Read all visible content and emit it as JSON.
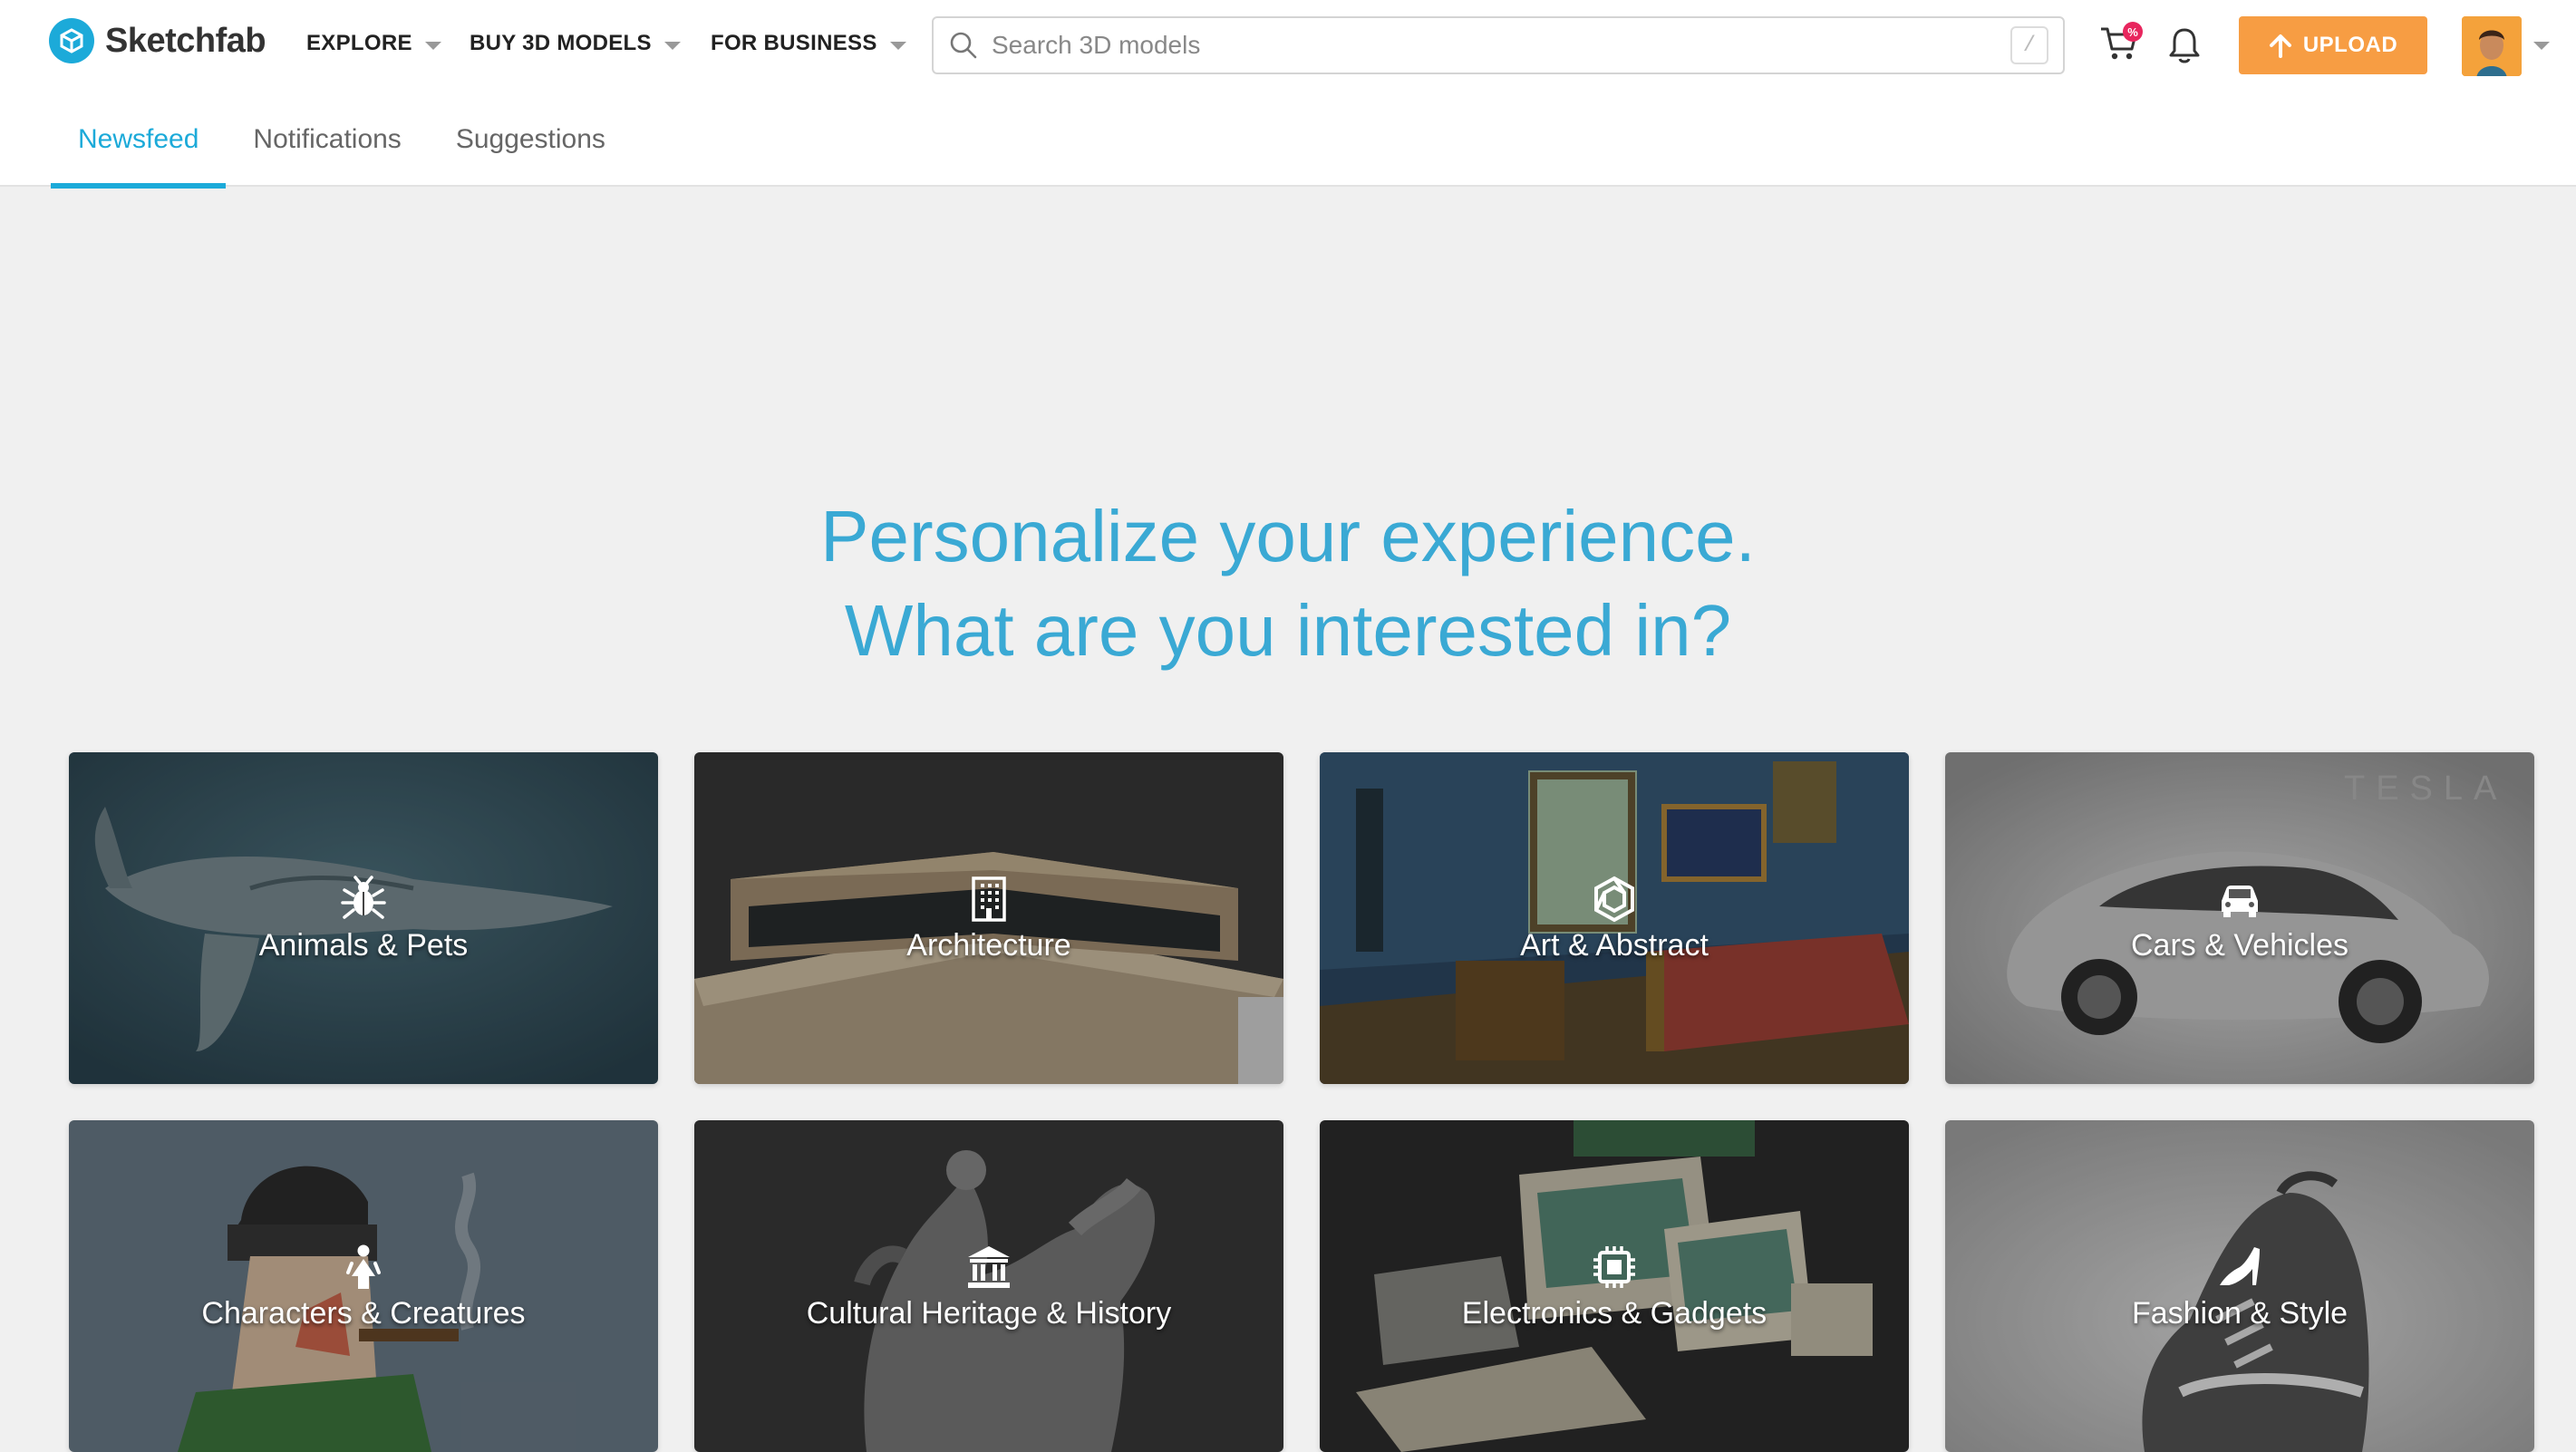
{
  "brand": {
    "name": "Sketchfab",
    "logo_icon": "sketchfab-cube-icon",
    "accent": "#1caad9"
  },
  "nav": {
    "explore_label": "EXPLORE",
    "buy_label": "BUY 3D MODELS",
    "business_label": "FOR BUSINESS"
  },
  "search": {
    "placeholder": "Search 3D models",
    "value": "",
    "shortcut_key": "/"
  },
  "cart": {
    "icon": "cart-icon",
    "badge_text": "%",
    "badge_color": "#e8265e"
  },
  "notifications_icon": "bell-icon",
  "upload": {
    "label": "UPLOAD",
    "icon": "arrow-up-icon",
    "color": "#f79d43"
  },
  "tabs": [
    {
      "label": "Newsfeed",
      "active": true
    },
    {
      "label": "Notifications",
      "active": false
    },
    {
      "label": "Suggestions",
      "active": false
    }
  ],
  "headline": {
    "line1": "Personalize your experience.",
    "line2": "What are you interested in?",
    "color": "#3aa9d4"
  },
  "categories": [
    {
      "label": "Animals & Pets",
      "icon": "bug-icon"
    },
    {
      "label": "Architecture",
      "icon": "building-icon"
    },
    {
      "label": "Art & Abstract",
      "icon": "abstract-knot-icon"
    },
    {
      "label": "Cars & Vehicles",
      "icon": "car-icon"
    },
    {
      "label": "Characters & Creatures",
      "icon": "person-icon"
    },
    {
      "label": "Cultural Heritage & History",
      "icon": "museum-icon"
    },
    {
      "label": "Electronics & Gadgets",
      "icon": "chip-icon"
    },
    {
      "label": "Fashion & Style",
      "icon": "high-heel-icon"
    }
  ],
  "tesla_watermark": "TESLA"
}
